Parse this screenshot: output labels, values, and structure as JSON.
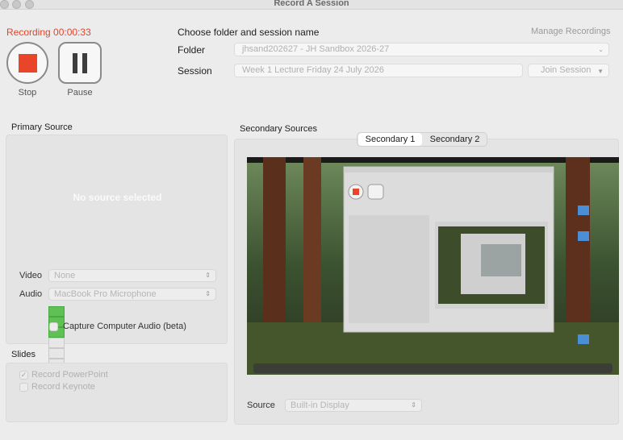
{
  "window": {
    "title": "Record A Session"
  },
  "recording": {
    "status": "Recording 00:00:33",
    "stop_label": "Stop",
    "pause_label": "Pause"
  },
  "session_header": "Choose folder and session name",
  "manage_recordings": "Manage Recordings",
  "folder": {
    "label": "Folder",
    "value": "jhsand202627 - JH Sandbox 2026-27"
  },
  "session": {
    "label": "Session",
    "value": "Week 1 Lecture Friday 24 July 2026",
    "join_label": "Join Session"
  },
  "primary": {
    "title": "Primary Source",
    "placeholder": "No source selected",
    "video_label": "Video",
    "video_value": "None",
    "audio_label": "Audio",
    "audio_value": "MacBook Pro Microphone",
    "meter_level": 0.3,
    "capture_audio_label": "Capture Computer Audio (beta)"
  },
  "slides": {
    "title": "Slides",
    "powerpoint_label": "Record PowerPoint",
    "powerpoint_checked": true,
    "keynote_label": "Record Keynote",
    "keynote_checked": false
  },
  "secondary": {
    "title": "Secondary Sources",
    "tabs": [
      "Secondary 1",
      "Secondary 2"
    ],
    "active_tab": 0,
    "source_label": "Source",
    "source_value": "Built-in Display"
  },
  "colors": {
    "recording_red": "#e2452c",
    "meter_green": "#5ec155"
  }
}
